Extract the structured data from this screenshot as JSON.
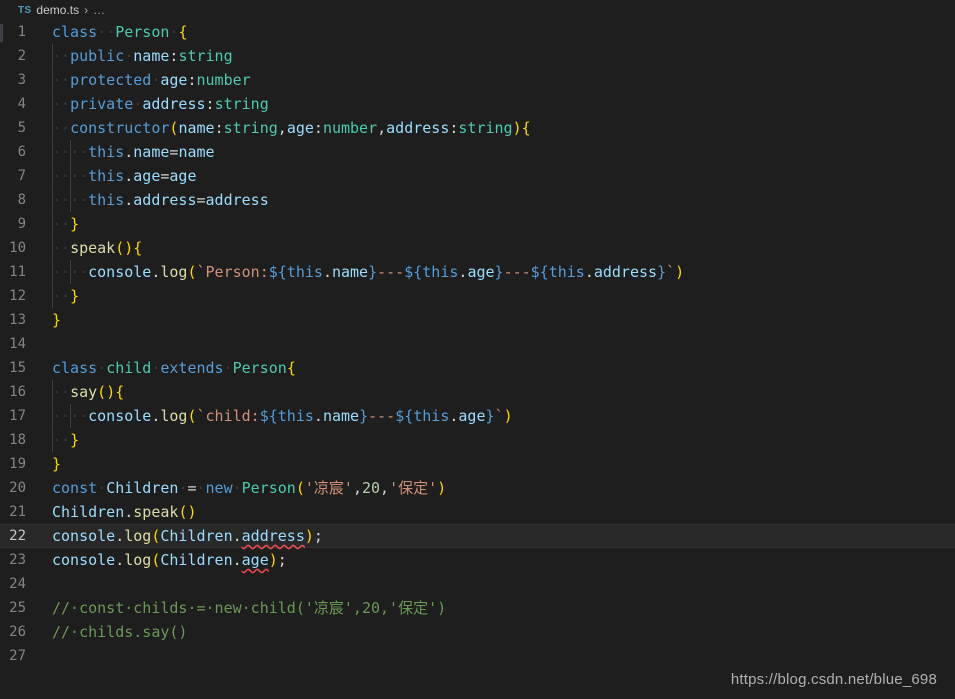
{
  "breadcrumb": {
    "file_type_badge": "TS",
    "file_name": "demo.ts",
    "separator": "›",
    "more": "…"
  },
  "editor": {
    "language": "TypeScript",
    "active_line": 22,
    "total_lines": 27,
    "theme": "Dark+ (default dark)",
    "colors": {
      "background": "#1e1e1e",
      "active_line_background": "#282828",
      "line_number": "#858585",
      "active_line_number": "#c6c6c6",
      "keyword": "#569cd6",
      "type": "#4ec9b0",
      "variable": "#9cdcfe",
      "function": "#dcdcaa",
      "string": "#ce9178",
      "number": "#b5cea8",
      "comment": "#6a9955",
      "punctuation": "#d4d4d4",
      "bracket1": "#ffd700",
      "bracket2": "#da70d6",
      "bracket3": "#179fff",
      "error_squiggle": "#f14c4c",
      "indent_guide": "#404040",
      "whitespace_dot": "#3b3b3b"
    },
    "line_numbers": [
      "1",
      "2",
      "3",
      "4",
      "5",
      "6",
      "7",
      "8",
      "9",
      "10",
      "11",
      "12",
      "13",
      "14",
      "15",
      "16",
      "17",
      "18",
      "19",
      "20",
      "21",
      "22",
      "23",
      "24",
      "25",
      "26",
      "27"
    ],
    "lines": [
      "class··Person·{",
      "··public·name:string",
      "··protected·age:number",
      "··private·address:string",
      "··constructor(name:string,age:number,address:string){",
      "····this.name=name",
      "····this.age=age",
      "····this.address=address",
      "··}",
      "··speak(){",
      "····console.log(`Person:${this.name}---${this.age}---${this.address}`)",
      "··}",
      "}",
      "",
      "class·child·extends·Person{",
      "··say(){",
      "····console.log(`child:${this.name}---${this.age}`)",
      "··}",
      "}",
      "const·Children·=·new·Person('凉宸',20,'保定')",
      "Children.speak()",
      "console.log(Children.address);",
      "console.log(Children.age);",
      "",
      "//·const·childs·=·new·child('凉宸',20,'保定')",
      "//·childs.say()",
      ""
    ],
    "diagnostics": [
      {
        "line": 22,
        "token": "address",
        "kind": "error"
      },
      {
        "line": 23,
        "token": "age",
        "kind": "error"
      }
    ]
  },
  "watermark": {
    "text": "https://blog.csdn.net/blue_698"
  }
}
